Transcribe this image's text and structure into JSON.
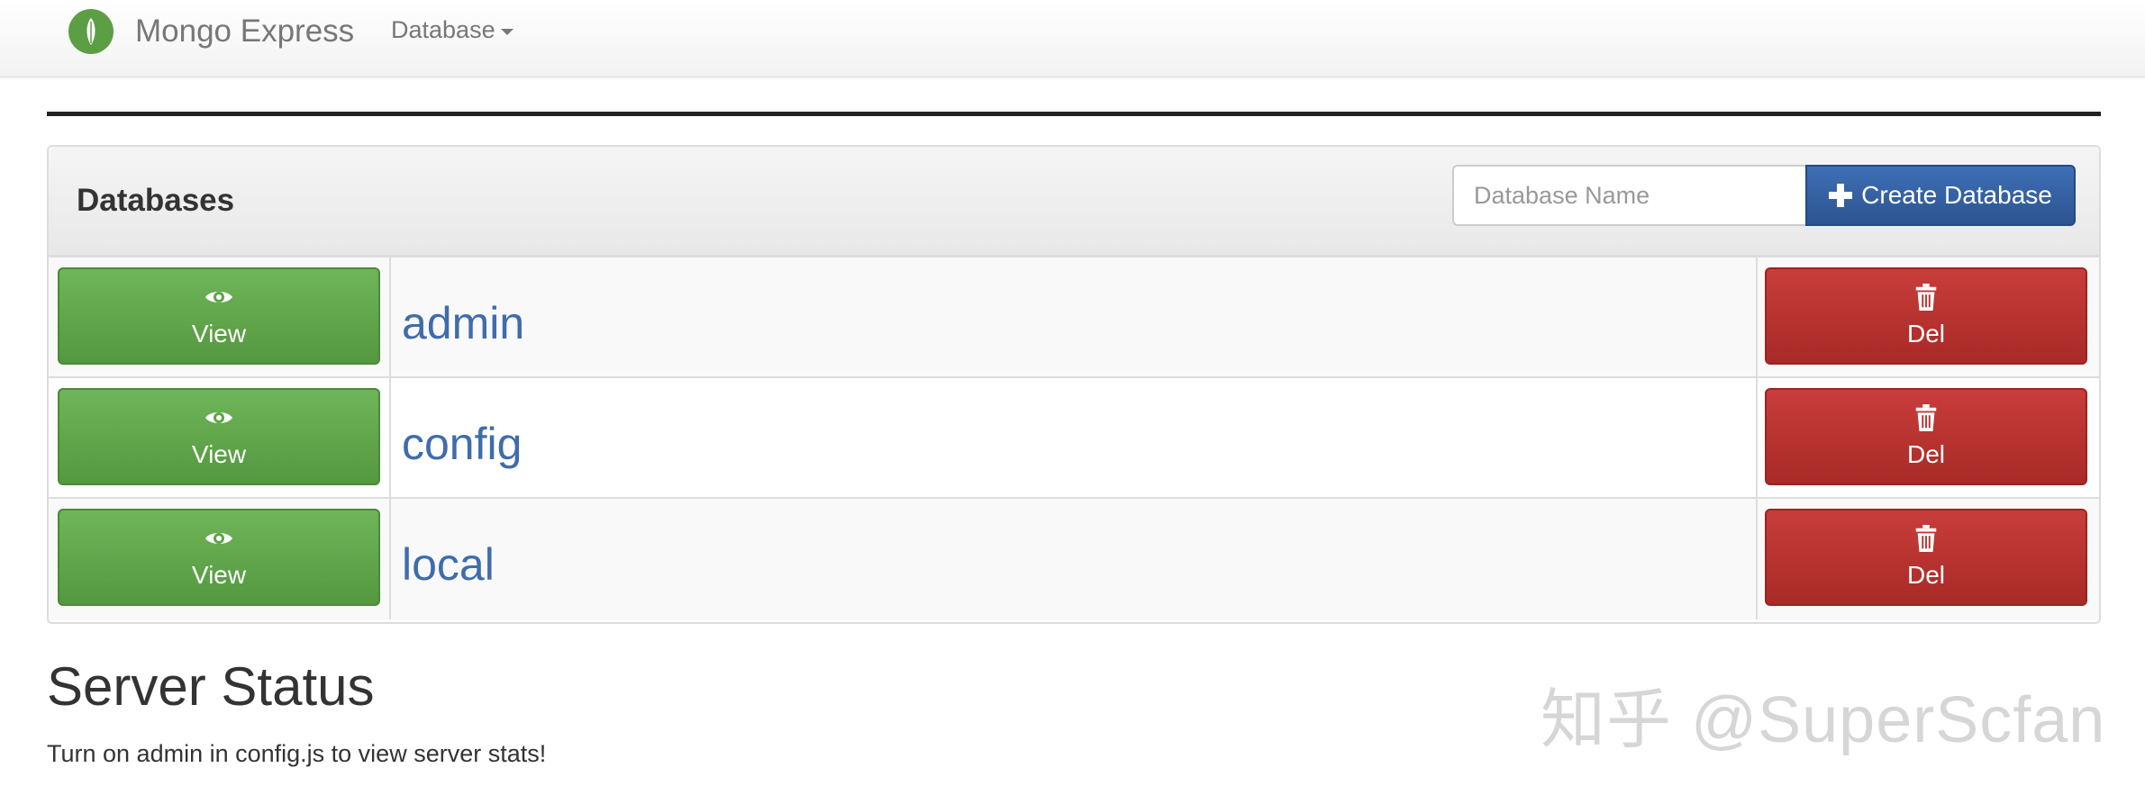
{
  "navbar": {
    "brand": "Mongo Express",
    "database_menu": "Database"
  },
  "panel": {
    "title": "Databases",
    "input_placeholder": "Database Name",
    "create_button": "Create Database"
  },
  "databases": [
    {
      "name": "admin",
      "view_label": "View",
      "delete_label": "Del"
    },
    {
      "name": "config",
      "view_label": "View",
      "delete_label": "Del"
    },
    {
      "name": "local",
      "view_label": "View",
      "delete_label": "Del"
    }
  ],
  "server_status": {
    "title": "Server Status",
    "message": "Turn on admin in config.js to view server stats!"
  },
  "watermark": "知乎 @SuperScfan",
  "colors": {
    "brand_green": "#5c9e44",
    "view_green": "#5da548",
    "delete_red": "#b3302d",
    "primary_blue": "#34619f",
    "link_blue": "#3f6cac"
  }
}
